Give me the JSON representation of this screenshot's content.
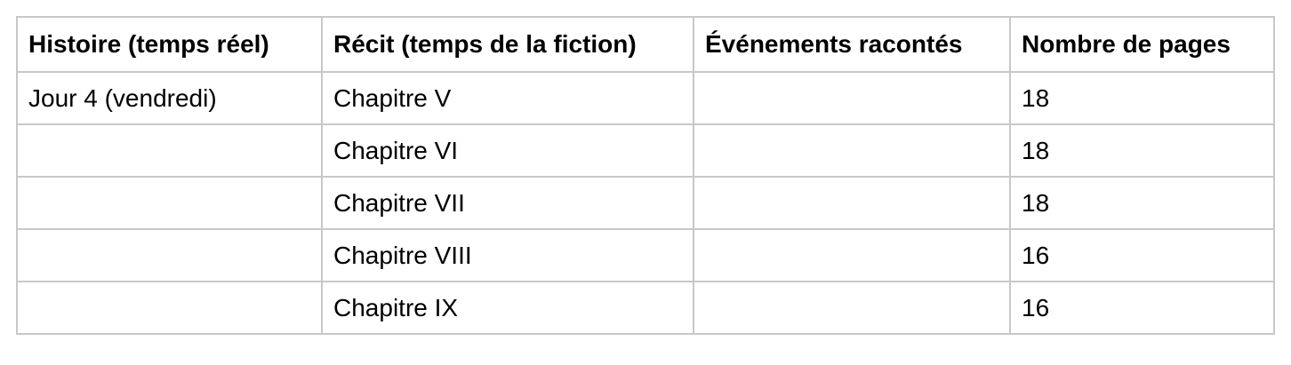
{
  "table": {
    "headers": [
      "Histoire (temps réel)",
      "Récit (temps de la fiction)",
      "Événements racontés",
      "Nombre de pages"
    ],
    "rows": [
      [
        "Jour 4 (vendredi)",
        "Chapitre V",
        "",
        "18"
      ],
      [
        "",
        "Chapitre VI",
        "",
        "18"
      ],
      [
        "",
        "Chapitre VII",
        "",
        "18"
      ],
      [
        "",
        "Chapitre VIII",
        "",
        "16"
      ],
      [
        "",
        "Chapitre IX",
        "",
        "16"
      ]
    ]
  }
}
